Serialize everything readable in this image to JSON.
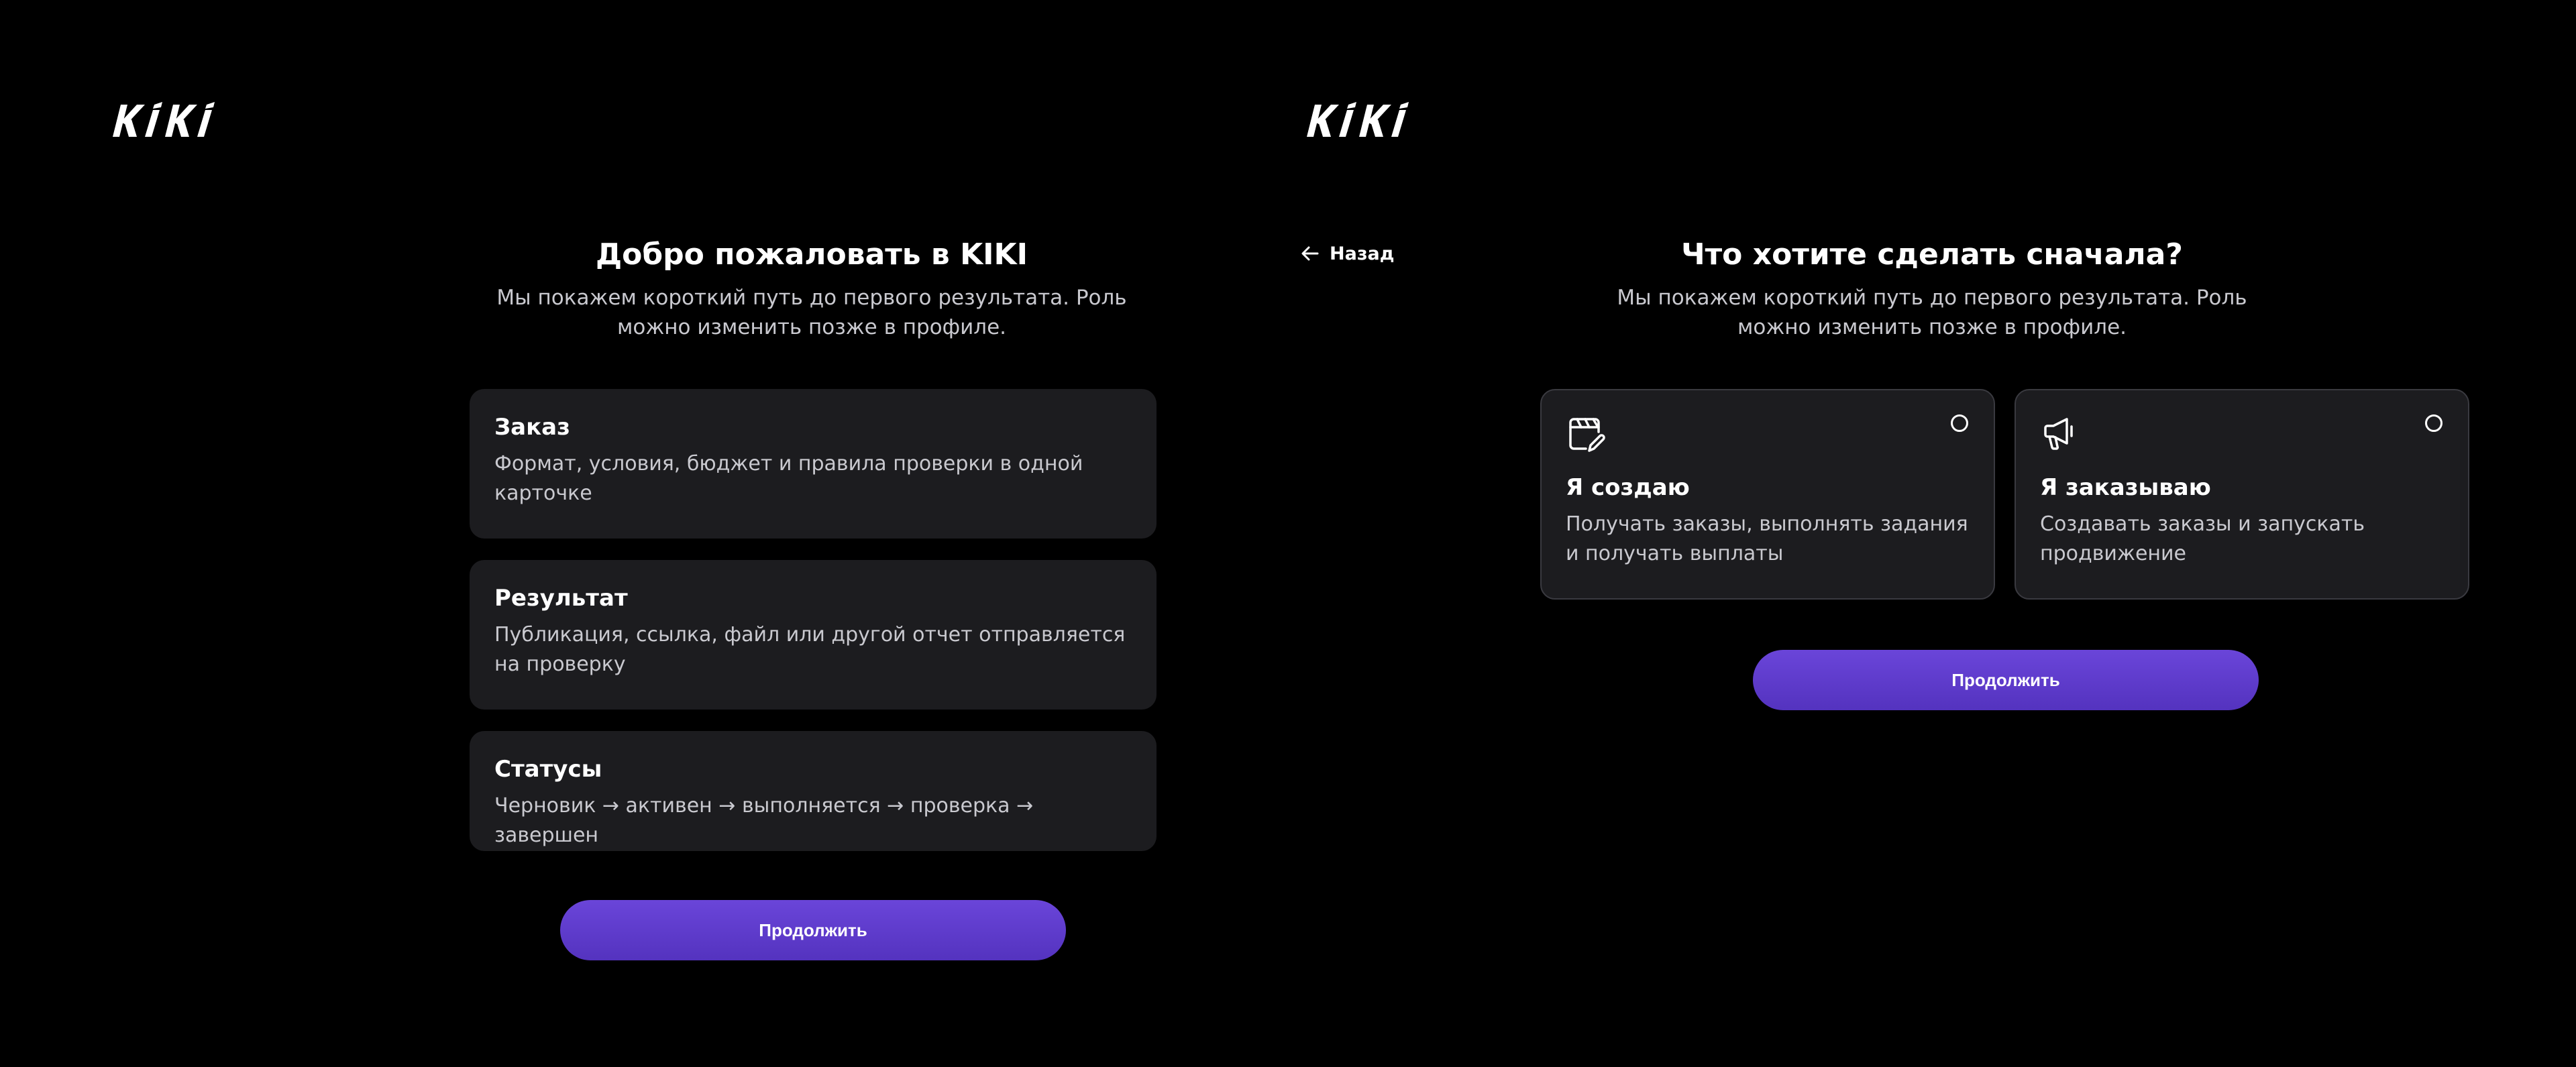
{
  "brand": {
    "logo_text": "KIKI"
  },
  "welcome_screen": {
    "title": "Добро пожаловать в KIKI",
    "subtitle": "Мы покажем короткий путь до первого результата. Роль можно изменить позже в профиле.",
    "cards": [
      {
        "title": "Заказ",
        "text": "Формат, условия, бюджет и правила проверки в одной карточке"
      },
      {
        "title": "Результат",
        "text": "Публикация, ссылка, файл или другой отчет отправляется на проверку"
      },
      {
        "title": "Статусы",
        "text": "Черновик → активен → выполняется → проверка → завершен"
      }
    ],
    "continue_label": "Продолжить"
  },
  "role_screen": {
    "back_label": "Назад",
    "title": "Что хотите сделать сначала?",
    "subtitle": "Мы покажем короткий путь до первого результата. Роль можно изменить позже в профиле.",
    "roles": [
      {
        "icon": "clapperboard-edit-icon",
        "title": "Я создаю",
        "text": "Получать заказы, выполнять задания и получать выплаты",
        "selected": false
      },
      {
        "icon": "megaphone-icon",
        "title": "Я заказываю",
        "text": "Создавать заказы и запускать продвижение",
        "selected": false
      }
    ],
    "continue_label": "Продолжить"
  },
  "colors": {
    "background": "#000000",
    "card": "#1c1c1f",
    "card_border": "#3a3a40",
    "accent": "#5f3dcc",
    "text_secondary": "#c9c9cf"
  }
}
